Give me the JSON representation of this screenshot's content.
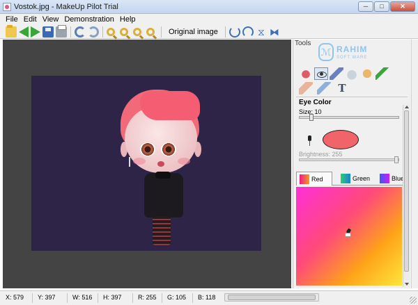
{
  "window": {
    "title": "Vostok.jpg - MakeUp Pilot Trial",
    "controls": {
      "minimize": "─",
      "maximize": "□",
      "close": "✕"
    }
  },
  "menu": [
    "File",
    "Edit",
    "View",
    "Demonstration",
    "Help"
  ],
  "toolbar": {
    "icons": [
      "open-icon",
      "back-icon",
      "forward-icon",
      "save-icon",
      "print-icon",
      "undo-icon",
      "redo-icon",
      "zoom-in-icon",
      "zoom-out-icon",
      "zoom-fit-icon",
      "zoom-actual-icon"
    ],
    "original_image_label": "Original image",
    "transform_icons": [
      "rotate-left-icon",
      "rotate-right-icon",
      "flip-vertical-icon",
      "flip-horizontal-icon"
    ],
    "flip_vertical_glyph": "⧖",
    "flip_horizontal_glyph": "⧓"
  },
  "tools_panel": {
    "header": "Tools",
    "watermark": {
      "badge": "ℳ",
      "line1": "RAHIM",
      "line2": "SOFT WARE"
    },
    "row1_tools": [
      "lips-tool",
      "eye-tool",
      "pencil-tool",
      "pot-tool",
      "palette-tool",
      "brush-tool"
    ],
    "row2_tools": [
      "eraser-tool",
      "feather-tool",
      "text-tool"
    ],
    "text_tool_glyph": "T",
    "section_title": "Eye Color",
    "size_label": "Size: 10",
    "size_value": 10,
    "size_fraction": 0.1,
    "selected_color": "#f0646a",
    "brightness_label": "Brightness: 255",
    "brightness_value": 255,
    "color_tabs": [
      {
        "label": "Red",
        "swatch": "sw-red",
        "selected": true
      },
      {
        "label": "Green",
        "swatch": "sw-green",
        "selected": false
      },
      {
        "label": "Blue",
        "swatch": "sw-blue",
        "selected": false
      }
    ]
  },
  "statusbar": {
    "x": "X: 579",
    "y": "Y: 397",
    "w": "W: 516",
    "h": "H: 397",
    "r": "R: 255",
    "g": "G: 105",
    "b": "B: 118"
  },
  "colors": {
    "canvas_bg": "#444444",
    "photo_bg": "#2e2448",
    "hair": "#f26a7a",
    "accent": "#3a69b8"
  }
}
